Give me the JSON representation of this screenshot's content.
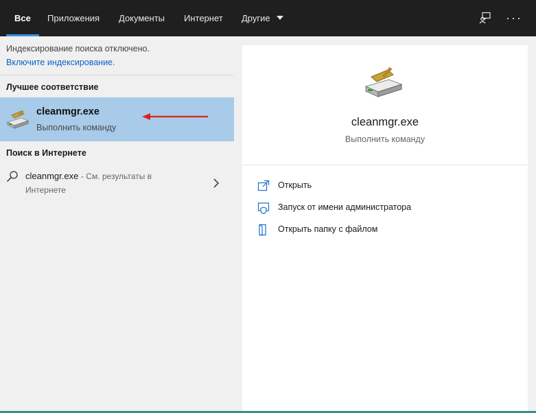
{
  "tabs": [
    {
      "label": "Все",
      "active": true
    },
    {
      "label": "Приложения"
    },
    {
      "label": "Документы"
    },
    {
      "label": "Интернет"
    },
    {
      "label": "Другие"
    }
  ],
  "topbar": {
    "feedback_icon": "feedback-icon",
    "more_label": "···"
  },
  "left": {
    "notice": "Индексирование поиска отключено.",
    "notice_link": "Включите индексирование.",
    "best_match_header": "Лучшее соответствие",
    "best_match": {
      "title": "cleanmgr.exe",
      "subtitle": "Выполнить команду"
    },
    "web_header": "Поиск в Интернете",
    "web_result": {
      "query": "cleanmgr.exe",
      "suffix": "- См. результаты в",
      "line2": "Интернете"
    }
  },
  "right": {
    "title": "cleanmgr.exe",
    "subtitle": "Выполнить команду",
    "actions": [
      {
        "label": "Открыть",
        "icon": "open-icon"
      },
      {
        "label": "Запуск от имени администратора",
        "icon": "run-as-admin-icon"
      },
      {
        "label": "Открыть папку с файлом",
        "icon": "open-folder-icon"
      }
    ]
  },
  "colors": {
    "accent": "#3c8fe0",
    "selection": "#a7cbe8",
    "link": "#0a62c2",
    "annotation_arrow": "#e02020"
  }
}
